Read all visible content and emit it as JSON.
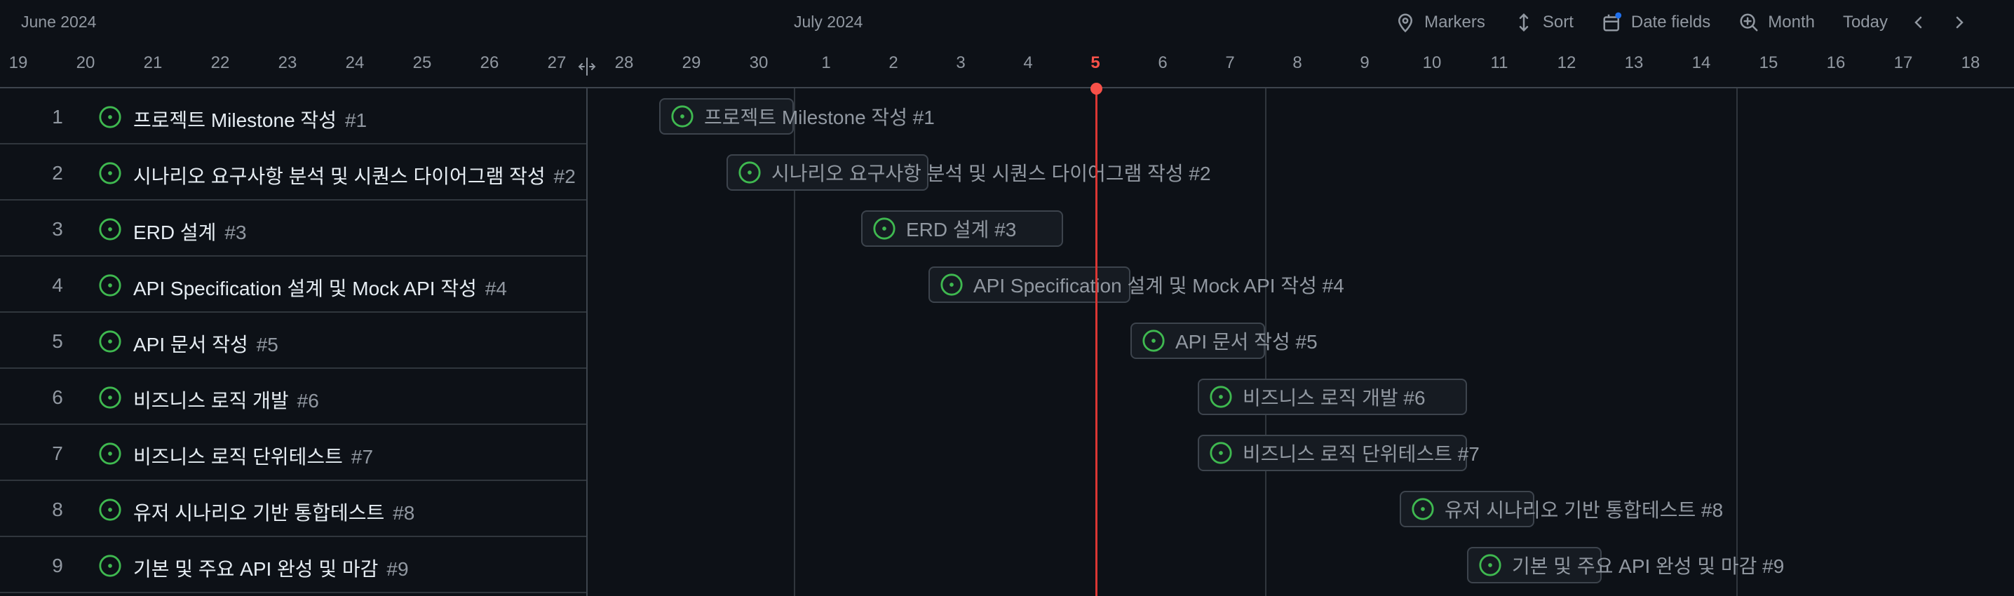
{
  "header": {
    "months": [
      "June 2024",
      "July 2024"
    ],
    "days": [
      "19",
      "20",
      "21",
      "22",
      "23",
      "24",
      "25",
      "26",
      "27",
      "28",
      "29",
      "30",
      "1",
      "2",
      "3",
      "4",
      "5",
      "6",
      "7",
      "8",
      "9",
      "10",
      "11",
      "12",
      "13",
      "14",
      "15",
      "16",
      "17",
      "18"
    ],
    "today": "5"
  },
  "toolbar": {
    "markers": "Markers",
    "sort": "Sort",
    "date_fields": "Date fields",
    "zoom": "Month",
    "today": "Today",
    "icons": [
      "marker-icon",
      "sort-icon",
      "calendar-icon",
      "zoom-icon",
      "chevron-left-icon",
      "chevron-right-icon"
    ]
  },
  "items": [
    {
      "num": "1",
      "title": "프로젝트 Milestone 작성",
      "id": "#1",
      "label": "프로젝트 Milestone 작성 #1"
    },
    {
      "num": "2",
      "title": "시나리오 요구사항 분석 및 시퀀스 다이어그램 작성",
      "id": "#2",
      "label": "시나리오 요구사항 분석 및 시퀀스 다이어그램 작성 #2"
    },
    {
      "num": "3",
      "title": "ERD 설계",
      "id": "#3",
      "label": "ERD 설계 #3"
    },
    {
      "num": "4",
      "title": "API Specification 설계 및 Mock API 작성",
      "id": "#4",
      "label": "API Specification 설계 및 Mock API 작성 #4"
    },
    {
      "num": "5",
      "title": "API 문서 작성",
      "id": "#5",
      "label": "API 문서 작성 #5"
    },
    {
      "num": "6",
      "title": "비즈니스 로직 개발",
      "id": "#6",
      "label": "비즈니스 로직 개발 #6"
    },
    {
      "num": "7",
      "title": "비즈니스 로직 단위테스트",
      "id": "#7",
      "label": "비즈니스 로직 단위테스트 #7"
    },
    {
      "num": "8",
      "title": "유저 시나리오 기반 통합테스트",
      "id": "#8",
      "label": "유저 시나리오 기반 통합테스트 #8"
    },
    {
      "num": "9",
      "title": "기본 및 주요 API 완성 및 마감",
      "id": "#9",
      "label": "기본 및 주요 API 완성 및 마감 #9"
    }
  ],
  "colors": {
    "background": "#0d1117",
    "open_status": "#3fb950",
    "today_marker": "#f85149",
    "date_fields_badge": "#1f6feb"
  }
}
